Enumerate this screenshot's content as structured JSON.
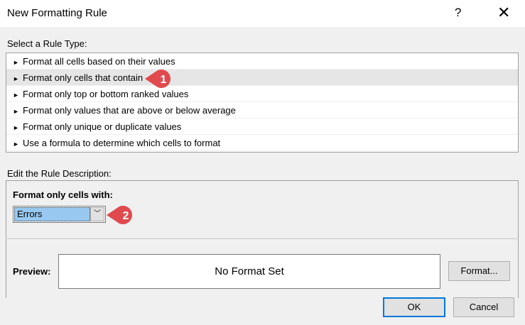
{
  "dialog": {
    "title": "New Formatting Rule",
    "help_label": "?",
    "close_label": "✕"
  },
  "rule_type": {
    "label": "Select a Rule Type:",
    "items": [
      "Format all cells based on their values",
      "Format only cells that contain",
      "Format only top or bottom ranked values",
      "Format only values that are above or below average",
      "Format only unique or duplicate values",
      "Use a formula to determine which cells to format"
    ],
    "selected_index": 1
  },
  "description": {
    "label": "Edit the Rule Description:",
    "subheading": "Format only cells with:",
    "select_value": "Errors"
  },
  "preview": {
    "label": "Preview:",
    "text": "No Format Set",
    "format_button": "Format..."
  },
  "buttons": {
    "ok": "OK",
    "cancel": "Cancel"
  },
  "callouts": [
    "1",
    "2"
  ],
  "colors": {
    "callout": "#e04a4f",
    "selection": "#99c9f0",
    "default_border": "#0078d7"
  }
}
